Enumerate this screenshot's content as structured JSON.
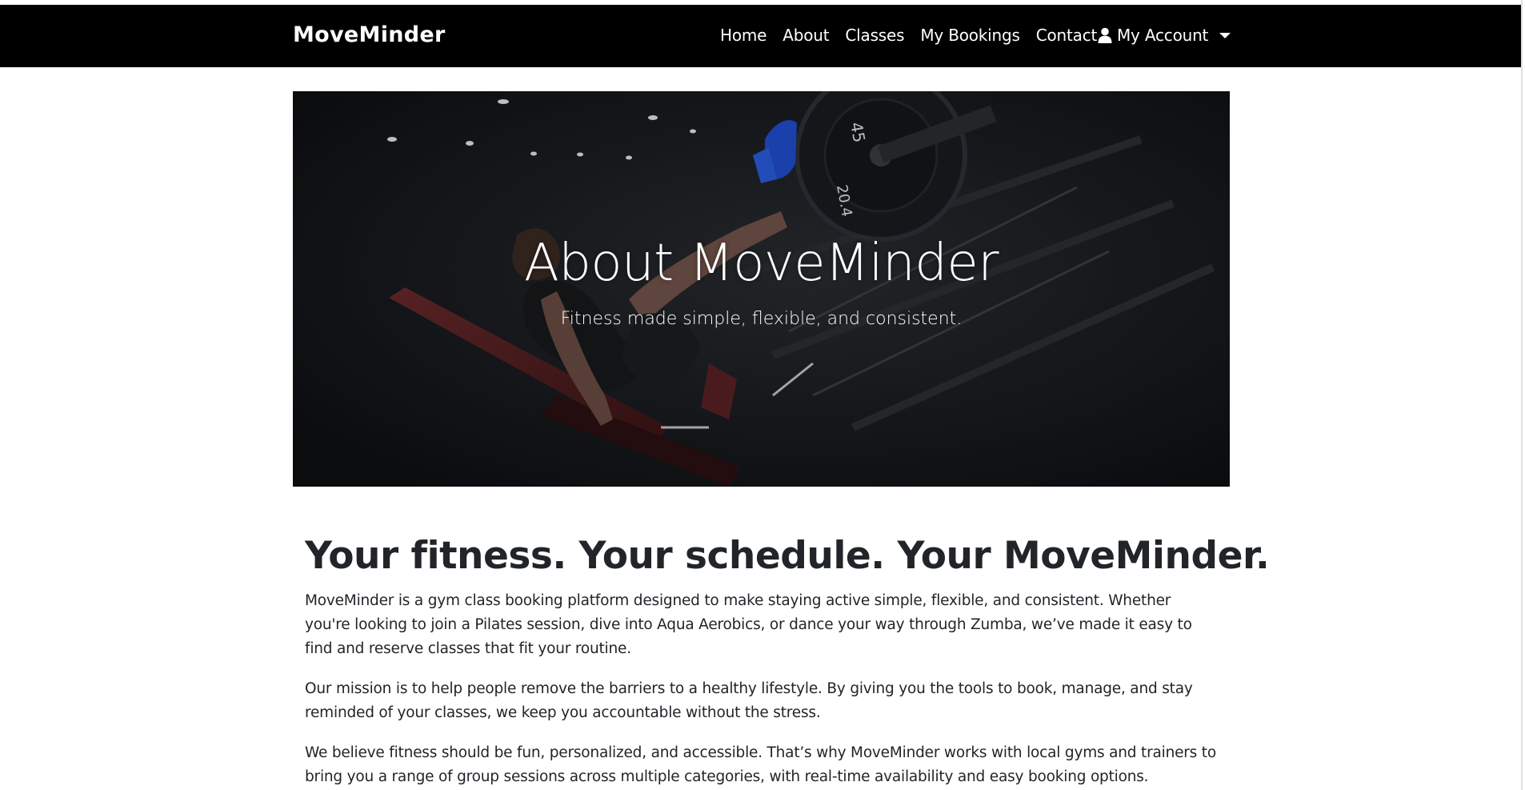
{
  "navbar": {
    "brand": "MoveMinder",
    "links": [
      "Home",
      "About",
      "Classes",
      "My Bookings",
      "Contact"
    ],
    "account_label": "My Account",
    "account_icon": "user-icon",
    "dropdown_icon": "caret-down-icon",
    "background_color": "#000000",
    "text_color": "#ffffff"
  },
  "hero": {
    "title": "About MoveMinder",
    "subtitle": "Fitness made simple, flexible, and consistent.",
    "image_plate_numbers": [
      "45",
      "20.4"
    ]
  },
  "main": {
    "headline": "Your fitness. Your schedule. Your MoveMinder.",
    "paragraphs": [
      "MoveMinder is a gym class booking platform designed to make staying active simple, flexible, and consistent. Whether you're looking to join a Pilates session, dive into Aqua Aerobics, or dance your way through Zumba, we’ve made it easy to find and reserve classes that fit your routine.",
      "Our mission is to help people remove the barriers to a healthy lifestyle. By giving you the tools to book, manage, and stay reminded of your classes, we keep you accountable without the stress.",
      "We believe fitness should be fun, personalized, and accessible. That’s why MoveMinder works with local gyms and trainers to bring you a range of group sessions across multiple categories, with real-time availability and easy booking options."
    ]
  }
}
